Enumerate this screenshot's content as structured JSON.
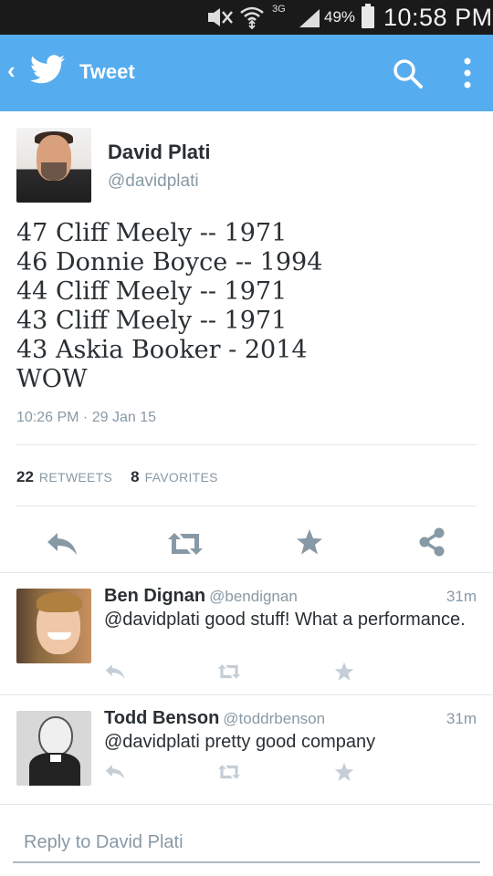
{
  "status_bar": {
    "network": "3G",
    "battery_percent": "49%",
    "time": "10:58 PM",
    "icons": [
      "mute-icon",
      "wifi-icon",
      "signal-icon",
      "battery-icon"
    ]
  },
  "header": {
    "title": "Tweet",
    "icons": [
      "back-chevron-icon",
      "twitter-bird-icon",
      "search-icon",
      "overflow-menu-icon"
    ],
    "background": "#55acee"
  },
  "tweet": {
    "author_name": "David Plati",
    "author_handle": "@davidplati",
    "lines": [
      "47 Cliff Meely -- 1971",
      "46 Donnie Boyce -- 1994",
      "44 Cliff Meely -- 1971",
      "43 Cliff Meely -- 1971",
      "43 Askia Booker - 2014",
      "WOW"
    ],
    "timestamp": "10:26 PM · 29 Jan 15",
    "retweets_count": "22",
    "retweets_label": "RETWEETS",
    "favorites_count": "8",
    "favorites_label": "FAVORITES",
    "actions": [
      "reply-icon",
      "retweet-icon",
      "favorite-icon",
      "share-icon"
    ]
  },
  "replies": [
    {
      "name": "Ben Dignan",
      "handle": "@bendignan",
      "time": "31m",
      "text": "@davidplati good stuff! What a performance."
    },
    {
      "name": "Todd Benson",
      "handle": "@toddrbenson",
      "time": "31m",
      "text": "@davidplati pretty good company"
    }
  ],
  "reply_box": {
    "placeholder": "Reply to David Plati"
  },
  "colors": {
    "accent": "#55acee",
    "text": "#292f33",
    "muted": "#8899a6",
    "divider": "#e1e8ed",
    "icon_gray": "#8899a6",
    "icon_light": "#c5ced6"
  }
}
